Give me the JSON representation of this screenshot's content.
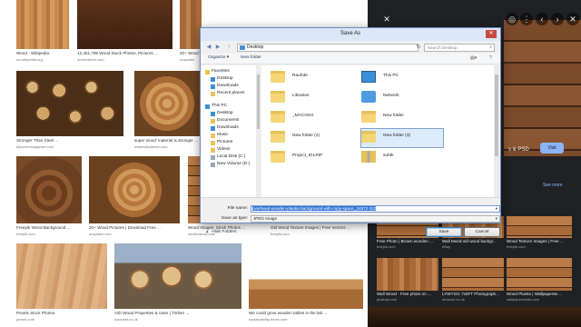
{
  "grid": {
    "thumbs": [
      {
        "caption": "Wood - Wikipedia",
        "source": "en.wikipedia.org"
      },
      {
        "caption": "12,461,799 Wood Stock Photos, Pictures ...",
        "source": "dreamstime.com"
      },
      {
        "caption": "20+ Wood",
        "source": "unsplash"
      },
      {
        "caption": "Stronger Than Steel ...",
        "source": "discovermagazine.com"
      },
      {
        "caption": "super wood' material is stronger ...",
        "source": "materialsdistrict.com"
      },
      {
        "caption": "Freepik Wood Background ...",
        "source": "freepik.com"
      },
      {
        "caption": "20+ Wood Pictures | Download Free ...",
        "source": "unsplash.com"
      },
      {
        "caption": "Wood Images, Stock Photos ...",
        "source": "shutterstock.com"
      },
      {
        "caption": "Old Wood Texture Images | Free Vectors ...",
        "source": "freepik.com"
      },
      {
        "caption": "Pexels Stock Photos",
        "source": "pexels.com"
      },
      {
        "caption": "Ash Wood Properties & Uses | Timber ...",
        "source": "woodset.co.uk"
      },
      {
        "caption": "We could grow wooden tables in the lab ...",
        "source": "sustainability-times.com"
      }
    ]
  },
  "preview": {
    "title_fragment": "s & PSD",
    "visit_label": "Visit",
    "see_more": "See more",
    "related": [
      {
        "caption": "Free Photo | Brown wooden ...",
        "source": "freepik.com"
      },
      {
        "caption": "Wall Mural old wood backgr...",
        "source": "eBay"
      },
      {
        "caption": "Wood Texture Images | Free ...",
        "source": "freepik.com"
      },
      {
        "caption": "Wall Wood - Free photo on ...",
        "source": "pixabay.com"
      },
      {
        "caption": "LYWYGG 7x5FT Photograph...",
        "source": "amazon.co.uk"
      },
      {
        "caption": "Wood Planks | Wallpaperse...",
        "source": "wallpaperswide.com"
      }
    ]
  },
  "dialog": {
    "title": "Save As",
    "close_glyph": "✕",
    "address": "Desktop",
    "search_placeholder": "Search Desktop",
    "toolbar": {
      "organize": "Organize ▾",
      "new_folder": "New folder"
    },
    "nav_items": [
      {
        "label": "Favorites",
        "icon": "star-icon",
        "color": "#f0c04b"
      },
      {
        "label": "Desktop",
        "icon": "desktop-icon",
        "color": "#3a8fd6"
      },
      {
        "label": "Downloads",
        "icon": "downloads-icon",
        "color": "#3a8fd6"
      },
      {
        "label": "Recent places",
        "icon": "recent-places-icon",
        "color": "#e8c25a"
      },
      {
        "label": "This PC",
        "icon": "computer-icon",
        "color": "#3a8fd6"
      },
      {
        "label": "Desktop",
        "icon": "desktop-icon",
        "color": "#3a8fd6"
      },
      {
        "label": "Documents",
        "icon": "documents-icon",
        "color": "#e8c25a"
      },
      {
        "label": "Downloads",
        "icon": "downloads-icon",
        "color": "#3a8fd6"
      },
      {
        "label": "Music",
        "icon": "music-icon",
        "color": "#e8c25a"
      },
      {
        "label": "Pictures",
        "icon": "pictures-icon",
        "color": "#e8c25a"
      },
      {
        "label": "Videos",
        "icon": "videos-icon",
        "color": "#e8c25a"
      },
      {
        "label": "Local Disk (C:)",
        "icon": "drive-icon",
        "color": "#9aa7b5"
      },
      {
        "label": "New Volume (D:)",
        "icon": "drive-icon",
        "color": "#9aa7b5"
      }
    ],
    "files": [
      {
        "name": "Rauhde",
        "icon": "folder-icon"
      },
      {
        "name": "This PC",
        "icon": "computer-icon"
      },
      {
        "name": "Libraries",
        "icon": "folder-icon"
      },
      {
        "name": "Network",
        "icon": "network-icon"
      },
      {
        "name": "_MACOSX",
        "icon": "folder-icon"
      },
      {
        "name": "New folder",
        "icon": "folder-icon"
      },
      {
        "name": "New folder (2)",
        "icon": "folder-icon"
      },
      {
        "name": "New folder (3)",
        "icon": "folder-icon"
      },
      {
        "name": "Project_IGLRIP",
        "icon": "folder-icon"
      },
      {
        "name": "subtk",
        "icon": "zip-folder-icon"
      }
    ],
    "file_name_label": "File name:",
    "file_name_value": "overhead-wooden-planks-background-with-copy-space_24972-322",
    "save_type_label": "Save as type:",
    "save_type_value": "JPEG Image",
    "hide_folders": "Hide Folders",
    "save_button": "Save",
    "cancel_button": "Cancel"
  }
}
